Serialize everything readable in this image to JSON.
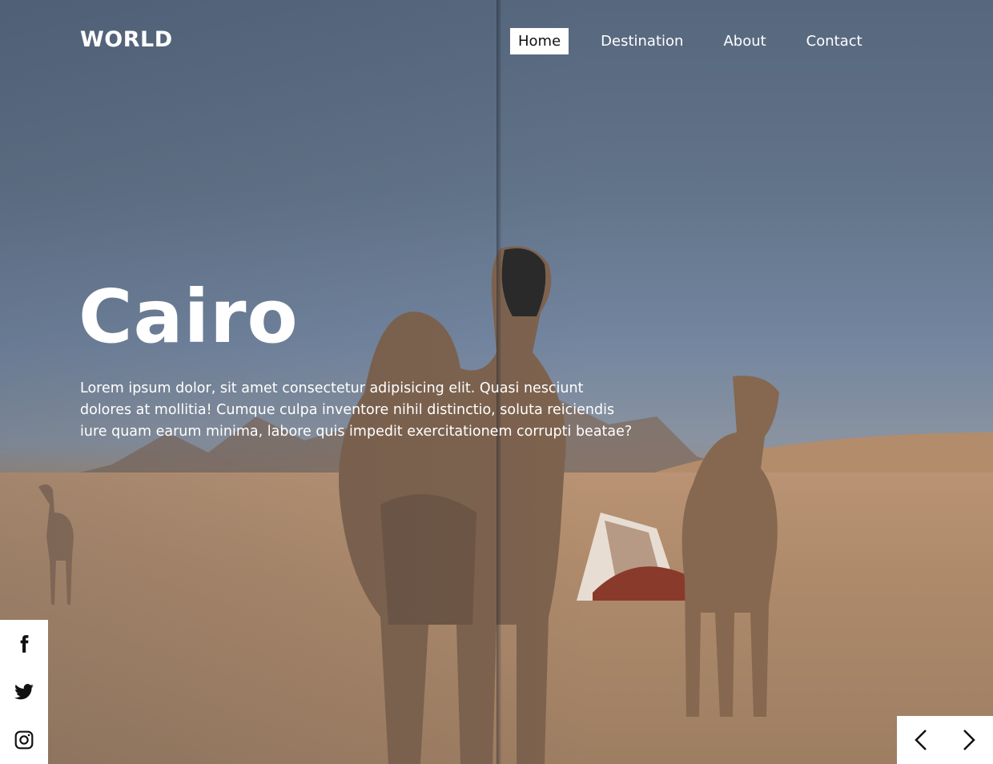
{
  "nav": {
    "logo": "WORLD",
    "links": [
      {
        "label": "Home",
        "active": true
      },
      {
        "label": "Destination",
        "active": false
      },
      {
        "label": "About",
        "active": false
      },
      {
        "label": "Contact",
        "active": false
      }
    ]
  },
  "hero": {
    "title": "Cairo",
    "description": "Lorem ipsum dolor, sit amet consectetur adipisicing elit. Quasi nesciunt dolores at mollitia! Cumque culpa inventore nihil distinctio, soluta reiciendis iure quam earum minima, labore quis impedit exercitationem corrupti beatae?"
  },
  "social": {
    "icons": [
      "facebook-icon",
      "twitter-icon",
      "instagram-icon"
    ]
  },
  "slider": {
    "icons": [
      "chevron-left-icon",
      "chevron-right-icon"
    ]
  },
  "colors": {
    "accent": "#ffffff",
    "text": "#ffffff",
    "active_nav_text": "#111111"
  }
}
